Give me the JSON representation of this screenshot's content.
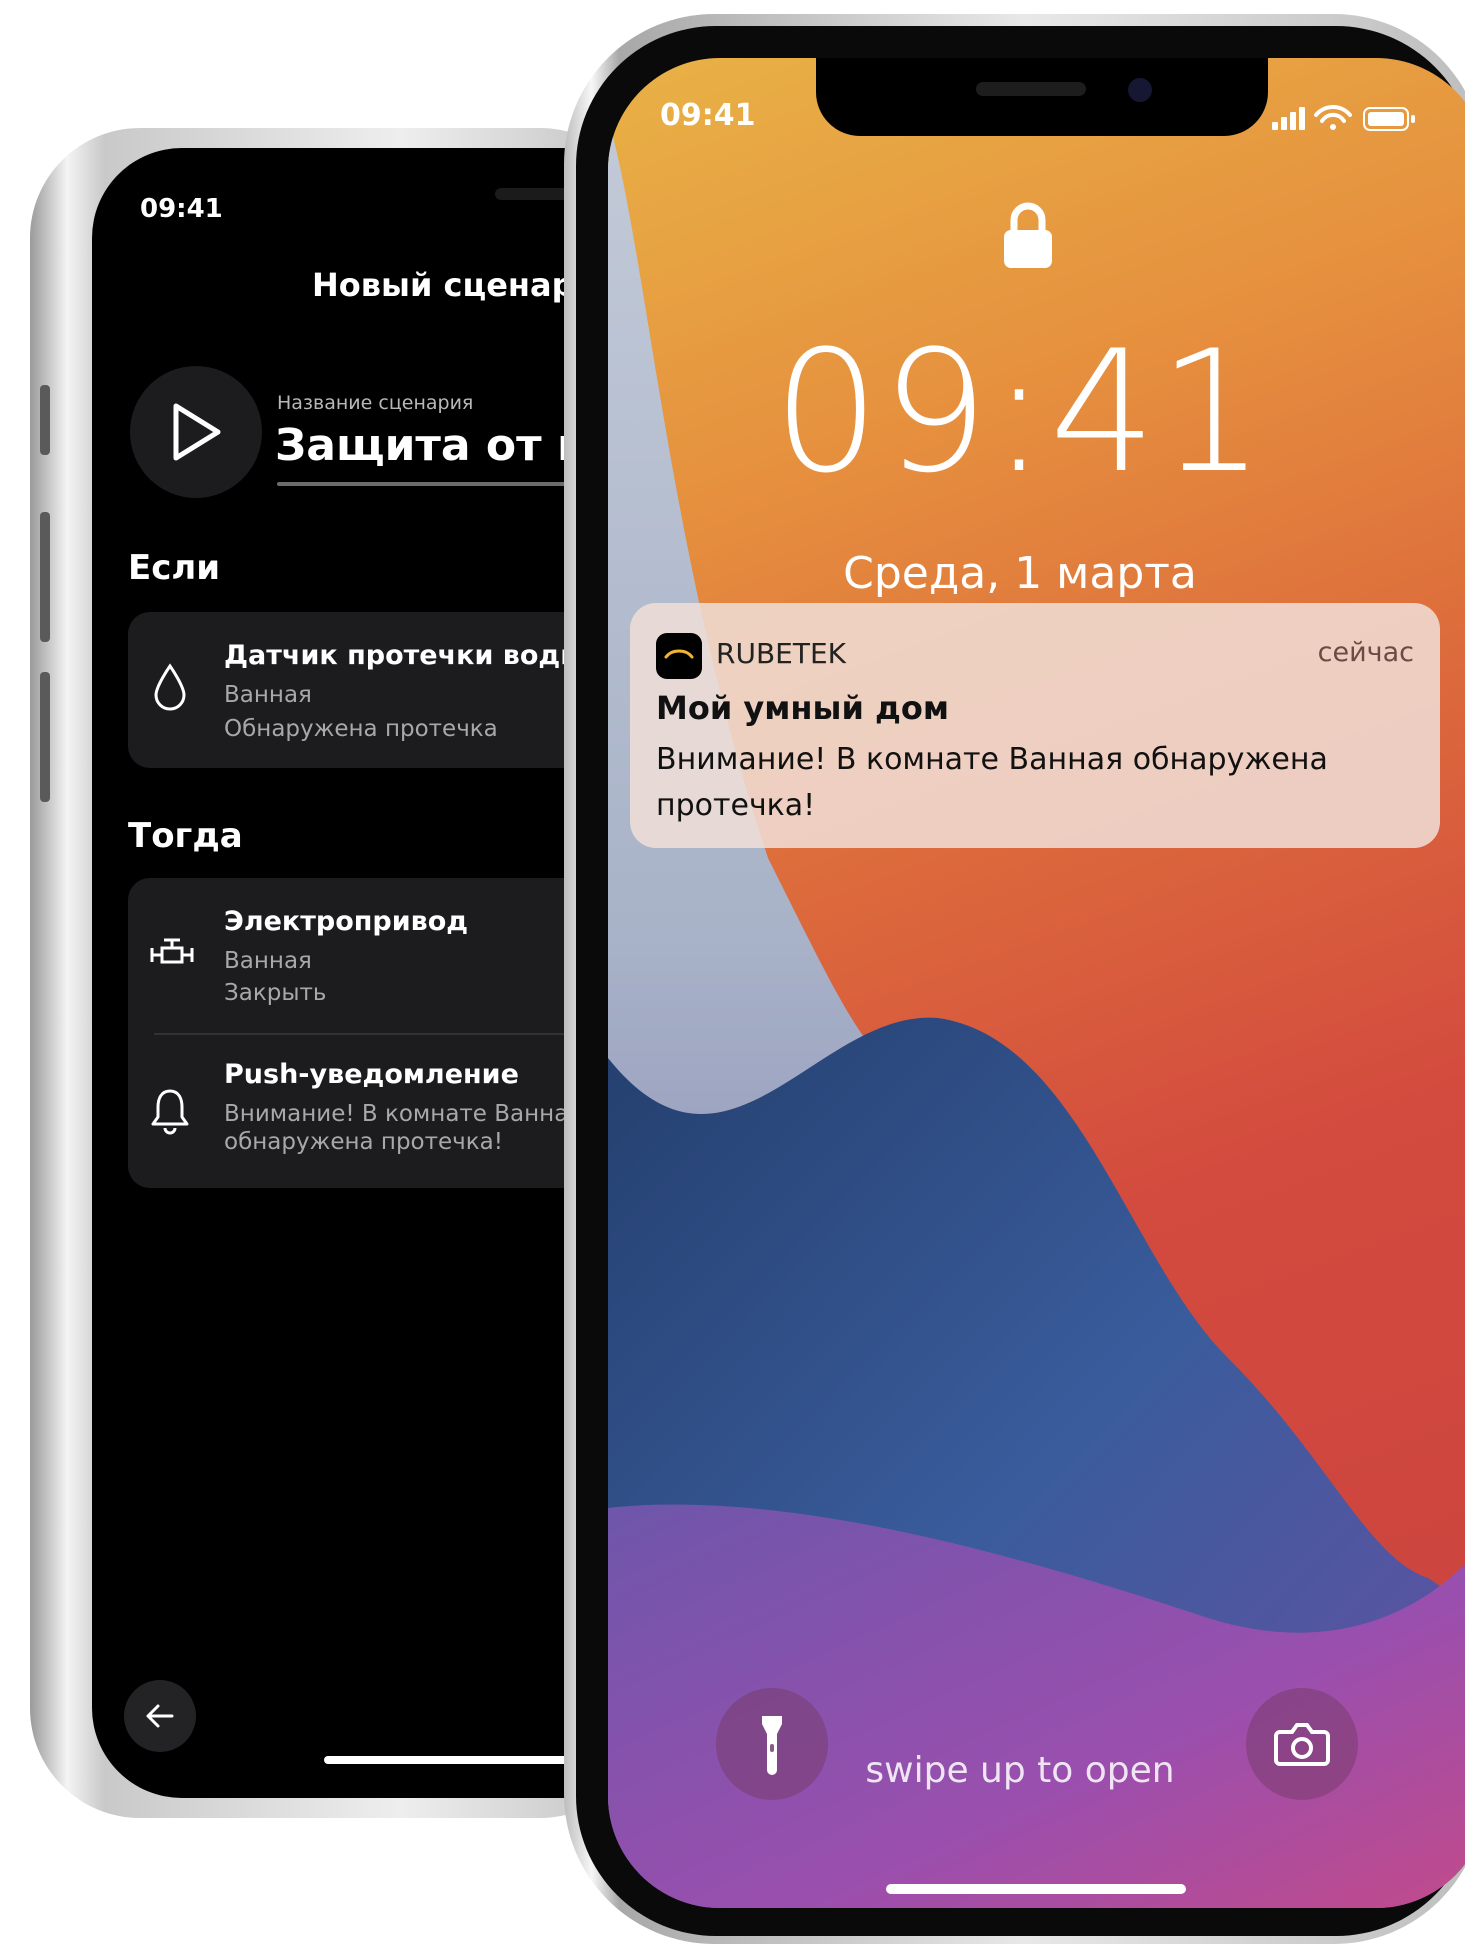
{
  "back_phone": {
    "status_time": "09:41",
    "title": "Новый сценарий",
    "scenario_name_label": "Название сценария",
    "scenario_name_value": "Защита от про",
    "if_section": {
      "heading": "Если",
      "item": {
        "icon": "water-drop-icon",
        "title": "Датчик протечки воды",
        "room": "Ванная",
        "state": "Обнаружена протечка"
      }
    },
    "then_section": {
      "heading": "Тогда",
      "items": [
        {
          "icon": "valve-actuator-icon",
          "title": "Электропривод",
          "room": "Ванная",
          "action": "Закрыть"
        },
        {
          "icon": "bell-icon",
          "title": "Push-уведомление",
          "line1": "Внимание! В комнате Ванная",
          "line2": "обнаружена протечка!"
        }
      ]
    }
  },
  "front_phone": {
    "status_time": "09:41",
    "clock": "09:41",
    "date": "Среда, 1 марта",
    "notification": {
      "app_name": "RUBETEK",
      "time": "сейчас",
      "title": "Мой умный дом",
      "body": "Внимание! В комнате Ванная обнаружена протечка!"
    },
    "swipe_hint": "swipe up to open",
    "colors": {
      "wallpaper_orange": "#e6903e",
      "wallpaper_red": "#d34a3e",
      "wallpaper_blue": "#2f5590",
      "wallpaper_purple": "#8a4aa8"
    }
  }
}
